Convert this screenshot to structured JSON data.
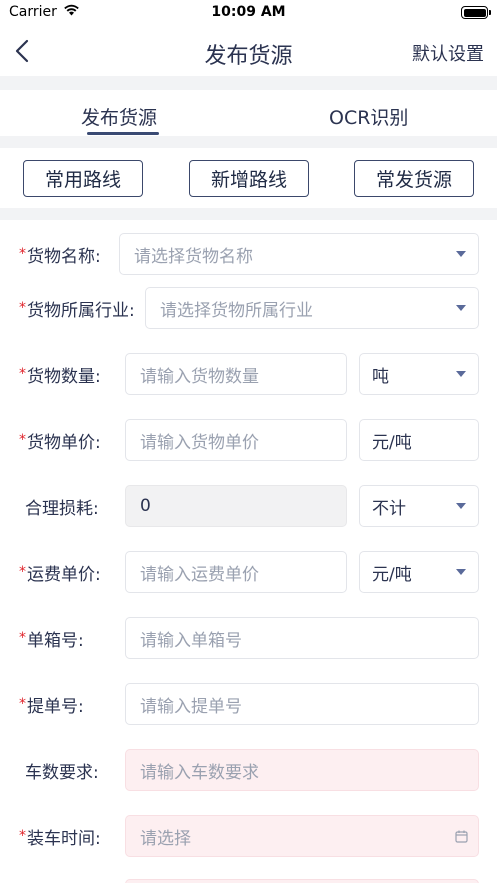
{
  "status": {
    "carrier": "Carrier",
    "time": "10:09 AM",
    "battery_level": 1.0
  },
  "nav": {
    "title": "发布货源",
    "right": "默认设置"
  },
  "tabs": [
    {
      "label": "发布货源"
    },
    {
      "label": "OCR识别"
    }
  ],
  "route_buttons": [
    {
      "label": "常用路线"
    },
    {
      "label": "新增路线"
    },
    {
      "label": "常发货源"
    }
  ],
  "required_mark": "*",
  "form": {
    "goods_name": {
      "label": "货物名称:",
      "placeholder": "请选择货物名称"
    },
    "industry": {
      "label": "货物所属行业:",
      "placeholder": "请选择货物所属行业"
    },
    "quantity": {
      "label": "货物数量:",
      "placeholder": "请输入货物数量",
      "unit": "吨"
    },
    "unit_price": {
      "label": "货物单价:",
      "placeholder": "请输入货物单价",
      "unit": "元/吨"
    },
    "loss": {
      "label": "合理损耗:",
      "value": "0",
      "unit": "不计"
    },
    "freight_price": {
      "label": "运费单价:",
      "placeholder": "请输入运费单价",
      "unit": "元/吨"
    },
    "box_no": {
      "label": "单箱号:",
      "placeholder": "请输入单箱号"
    },
    "bill_no": {
      "label": "提单号:",
      "placeholder": "请输入提单号"
    },
    "truck_req": {
      "label": "车数要求:",
      "placeholder": "请输入车数要求"
    },
    "load_time": {
      "label": "装车时间:",
      "placeholder": "请选择"
    }
  },
  "colors": {
    "accent": "#3a4a73",
    "required": "#e0242b",
    "placeholder": "#9aa1b0",
    "section_bg": "#f2f3f5"
  },
  "icons": {
    "back": "chevron-left-icon",
    "dropdown": "caret-down-icon",
    "calendar": "calendar-icon",
    "wifi": "wifi-icon",
    "battery": "battery-icon"
  }
}
